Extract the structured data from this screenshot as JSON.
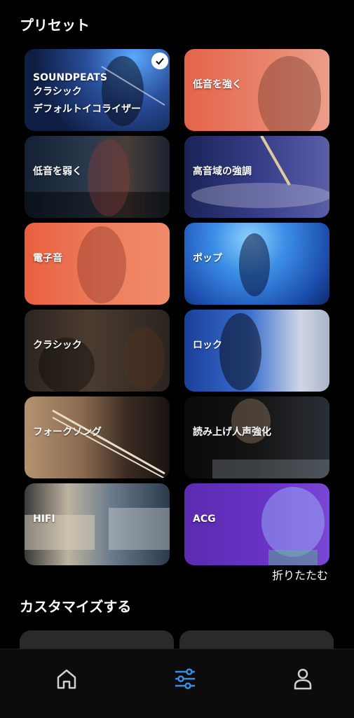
{
  "sections": {
    "presets_title": "プリセット",
    "custom_title": "カスタマイズする"
  },
  "presets": [
    {
      "label_lines": [
        "SOUNDPEATS",
        "クラシック",
        "デフォルトイコライザー"
      ],
      "selected": true
    },
    {
      "label": "低音を強く"
    },
    {
      "label": "低音を弱く"
    },
    {
      "label": "高音域の強調"
    },
    {
      "label": "電子音"
    },
    {
      "label": "ポップ"
    },
    {
      "label": "クラシック"
    },
    {
      "label": "ロック"
    },
    {
      "label": "フォークソング"
    },
    {
      "label": "読み上げ人声強化"
    },
    {
      "label": "HIFI"
    },
    {
      "label": "ACG"
    }
  ],
  "collapse_label": "折りたたむ",
  "tab_bar": {
    "tabs": [
      {
        "name": "home",
        "icon": "home-icon",
        "active": false
      },
      {
        "name": "equalizer",
        "icon": "sliders-icon",
        "active": true
      },
      {
        "name": "profile",
        "icon": "person-icon",
        "active": false
      }
    ],
    "active_color": "#3a8ee6",
    "inactive_color": "#d0d0d0"
  }
}
